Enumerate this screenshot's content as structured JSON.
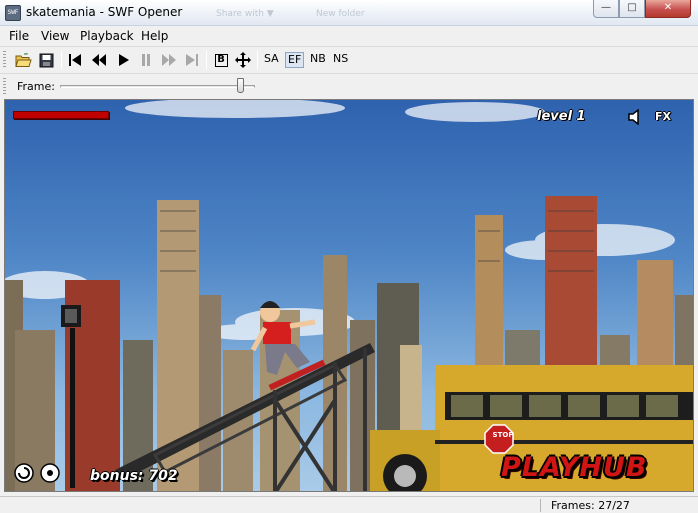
{
  "window": {
    "title": "skatemania - SWF Opener",
    "ghost_tabs": [
      "Share with ▼",
      "New folder"
    ],
    "minimize_glyph": "—",
    "maximize_glyph": "□",
    "close_glyph": "✕"
  },
  "menu": [
    {
      "label": "File"
    },
    {
      "label": "View"
    },
    {
      "label": "Playback"
    },
    {
      "label": "Help"
    }
  ],
  "toolbar": {
    "icons": [
      "open-folder-icon",
      "save-icon",
      "skip-to-start-icon",
      "rewind-icon",
      "play-icon",
      "pause-icon",
      "fast-forward-icon",
      "skip-to-end-icon",
      "border-toggle-icon",
      "move-icon"
    ],
    "border_label": "B",
    "scale_buttons": [
      {
        "label": "SA",
        "active": false
      },
      {
        "label": "EF",
        "active": true
      },
      {
        "label": "NB",
        "active": false
      },
      {
        "label": "NS",
        "active": false
      }
    ]
  },
  "frame_bar": {
    "label": "Frame:",
    "position_fraction": 0.94
  },
  "game": {
    "health_fraction": 1.0,
    "health_color": "#c00000",
    "level_label": "level 1",
    "fx_label": "FX",
    "bonus_label": "bonus: 702",
    "brand": "PLAYHUB",
    "stop_sign": "STOP",
    "sky_color": "#3f76bd",
    "brand_color": "#d11414"
  },
  "status": {
    "frames": "Frames: 27/27"
  }
}
